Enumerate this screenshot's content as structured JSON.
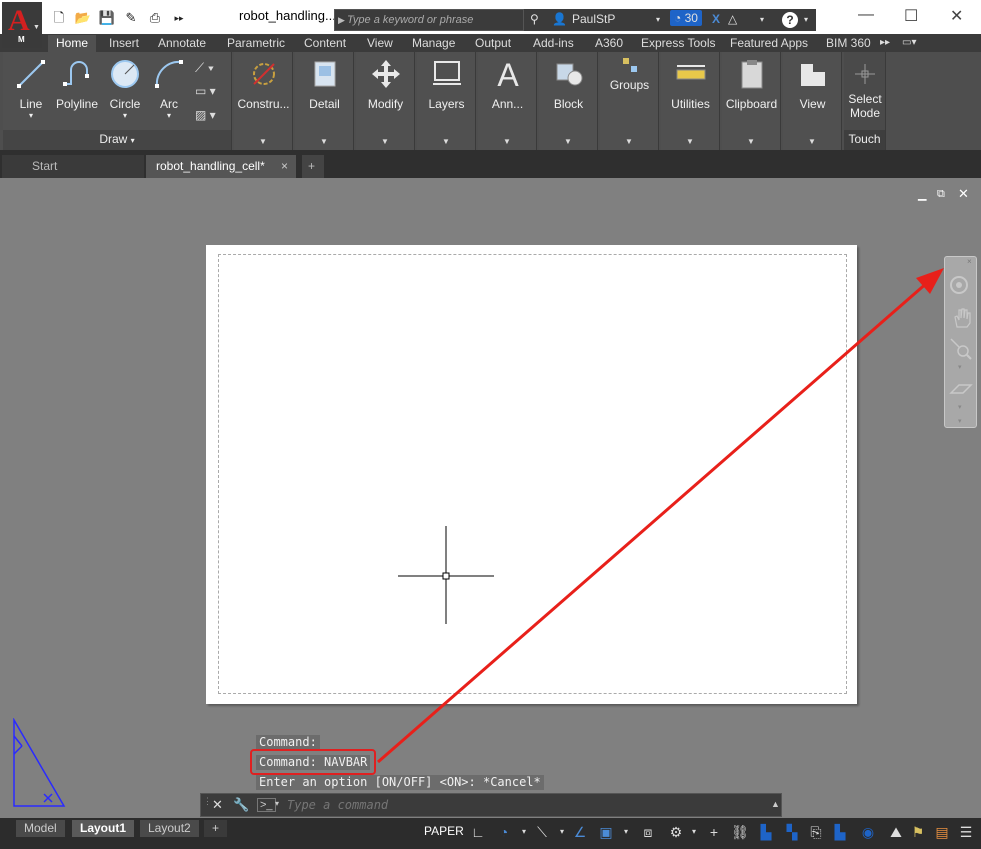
{
  "window": {
    "title": "robot_handling...",
    "search_placeholder": "Type a keyword or phrase",
    "user": "PaulStP",
    "trial_days": "30",
    "app_letter": "A",
    "app_sub": "M"
  },
  "ribbon_tabs": [
    "Home",
    "Insert",
    "Annotate",
    "Parametric",
    "Content",
    "View",
    "Manage",
    "Output",
    "Add-ins",
    "A360",
    "Express Tools",
    "Featured Apps",
    "BIM 360"
  ],
  "ribbon": {
    "draw": {
      "line": "Line",
      "polyline": "Polyline",
      "circle": "Circle",
      "arc": "Arc",
      "footer": "Draw"
    },
    "panels": [
      "Constru...",
      "Detail",
      "Modify",
      "Layers",
      "Ann...",
      "Block",
      "Groups",
      "Utilities",
      "Clipboard",
      "View"
    ],
    "select_mode": "Select Mode",
    "touch": "Touch"
  },
  "file_tabs": {
    "start": "Start",
    "active": "robot_handling_cell*"
  },
  "command_history": [
    "Command:",
    "Command: NAVBAR",
    "Enter an option [ON/OFF] <ON>: *Cancel*"
  ],
  "command_input_placeholder": "Type a command",
  "layout_tabs": [
    "Model",
    "Layout1",
    "Layout2"
  ],
  "status": {
    "paper": "PAPER"
  },
  "colors": {
    "app_red": "#d42020",
    "arrow_red": "#e8201a",
    "highlight_box": "#e02020",
    "accent_blue": "#1e64c8"
  }
}
